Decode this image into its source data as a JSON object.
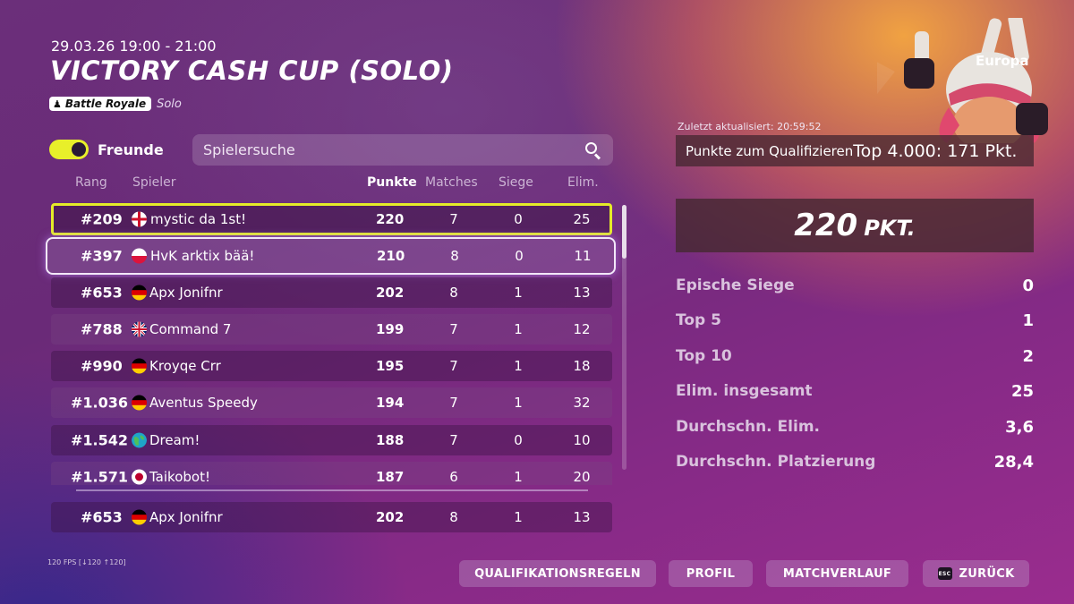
{
  "header": {
    "date": "29.03.26 19:00 - 21:00",
    "title": "VICTORY CASH CUP (SOLO)",
    "mode_badge": "Battle Royale",
    "mode_sub": "Solo"
  },
  "friends_toggle": {
    "label": "Freunde",
    "on": true
  },
  "search": {
    "placeholder": "Spielersuche"
  },
  "columns": {
    "rank": "Rang",
    "player": "Spieler",
    "points": "Punkte",
    "matches": "Matches",
    "wins": "Siege",
    "elims": "Elim."
  },
  "rows": [
    {
      "rank": "#209",
      "flag": "england",
      "player": "mystic da 1st!",
      "points": "220",
      "matches": "7",
      "wins": "0",
      "elims": "25"
    },
    {
      "rank": "#397",
      "flag": "poland",
      "player": "HvK arktix bää!",
      "points": "210",
      "matches": "8",
      "wins": "0",
      "elims": "11"
    },
    {
      "rank": "#653",
      "flag": "germany",
      "player": "Apx Jonifnr",
      "points": "202",
      "matches": "8",
      "wins": "1",
      "elims": "13"
    },
    {
      "rank": "#788",
      "flag": "uk",
      "player": "Command 7",
      "points": "199",
      "matches": "7",
      "wins": "1",
      "elims": "12"
    },
    {
      "rank": "#990",
      "flag": "germany",
      "player": "Kroyqe Crr",
      "points": "195",
      "matches": "7",
      "wins": "1",
      "elims": "18"
    },
    {
      "rank": "#1.036",
      "flag": "germany",
      "player": "Aventus Speedy",
      "points": "194",
      "matches": "7",
      "wins": "1",
      "elims": "32"
    },
    {
      "rank": "#1.542",
      "flag": "globe",
      "player": "Dream!",
      "points": "188",
      "matches": "7",
      "wins": "0",
      "elims": "10"
    },
    {
      "rank": "#1.571",
      "flag": "japan",
      "player": "Taikobot!",
      "points": "187",
      "matches": "6",
      "wins": "1",
      "elims": "20"
    }
  ],
  "pinned_row": {
    "rank": "#653",
    "flag": "germany",
    "player": "Apx Jonifnr",
    "points": "202",
    "matches": "8",
    "wins": "1",
    "elims": "13"
  },
  "right_panel": {
    "region": "Europa",
    "updated": "Zuletzt aktualisiert: 20:59:52",
    "qualify_label": "Punkte zum Qualifizieren",
    "qualify_value": "Top 4.000: 171 Pkt.",
    "points_value": "220",
    "points_unit": "PKT.",
    "stats": [
      {
        "label": "Epische Siege",
        "value": "0"
      },
      {
        "label": "Top 5",
        "value": "1"
      },
      {
        "label": "Top 10",
        "value": "2"
      },
      {
        "label": "Elim. insgesamt",
        "value": "25"
      },
      {
        "label": "Durchschn. Elim.",
        "value": "3,6"
      },
      {
        "label": "Durchschn. Platzierung",
        "value": "28,4"
      }
    ]
  },
  "fps": "120 FPS [↓120 ↑120]",
  "buttons": {
    "rules": "QUALIFIKATIONSREGELN",
    "profile": "PROFIL",
    "history": "MATCHVERLAUF",
    "esc_key": "ESC",
    "back": "ZURÜCK"
  },
  "colors": {
    "highlight": "#e5ec28",
    "toggle_on": "#e8ef2a"
  }
}
